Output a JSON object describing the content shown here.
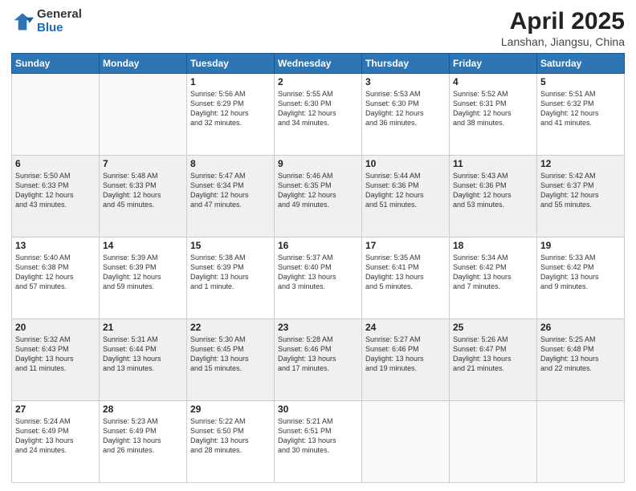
{
  "logo": {
    "general": "General",
    "blue": "Blue"
  },
  "title": {
    "month": "April 2025",
    "location": "Lanshan, Jiangsu, China"
  },
  "weekdays": [
    "Sunday",
    "Monday",
    "Tuesday",
    "Wednesday",
    "Thursday",
    "Friday",
    "Saturday"
  ],
  "days": [
    {
      "num": "",
      "info": ""
    },
    {
      "num": "",
      "info": ""
    },
    {
      "num": "1",
      "info": "Sunrise: 5:56 AM\nSunset: 6:29 PM\nDaylight: 12 hours\nand 32 minutes."
    },
    {
      "num": "2",
      "info": "Sunrise: 5:55 AM\nSunset: 6:30 PM\nDaylight: 12 hours\nand 34 minutes."
    },
    {
      "num": "3",
      "info": "Sunrise: 5:53 AM\nSunset: 6:30 PM\nDaylight: 12 hours\nand 36 minutes."
    },
    {
      "num": "4",
      "info": "Sunrise: 5:52 AM\nSunset: 6:31 PM\nDaylight: 12 hours\nand 38 minutes."
    },
    {
      "num": "5",
      "info": "Sunrise: 5:51 AM\nSunset: 6:32 PM\nDaylight: 12 hours\nand 41 minutes."
    },
    {
      "num": "6",
      "info": "Sunrise: 5:50 AM\nSunset: 6:33 PM\nDaylight: 12 hours\nand 43 minutes."
    },
    {
      "num": "7",
      "info": "Sunrise: 5:48 AM\nSunset: 6:33 PM\nDaylight: 12 hours\nand 45 minutes."
    },
    {
      "num": "8",
      "info": "Sunrise: 5:47 AM\nSunset: 6:34 PM\nDaylight: 12 hours\nand 47 minutes."
    },
    {
      "num": "9",
      "info": "Sunrise: 5:46 AM\nSunset: 6:35 PM\nDaylight: 12 hours\nand 49 minutes."
    },
    {
      "num": "10",
      "info": "Sunrise: 5:44 AM\nSunset: 6:36 PM\nDaylight: 12 hours\nand 51 minutes."
    },
    {
      "num": "11",
      "info": "Sunrise: 5:43 AM\nSunset: 6:36 PM\nDaylight: 12 hours\nand 53 minutes."
    },
    {
      "num": "12",
      "info": "Sunrise: 5:42 AM\nSunset: 6:37 PM\nDaylight: 12 hours\nand 55 minutes."
    },
    {
      "num": "13",
      "info": "Sunrise: 5:40 AM\nSunset: 6:38 PM\nDaylight: 12 hours\nand 57 minutes."
    },
    {
      "num": "14",
      "info": "Sunrise: 5:39 AM\nSunset: 6:39 PM\nDaylight: 12 hours\nand 59 minutes."
    },
    {
      "num": "15",
      "info": "Sunrise: 5:38 AM\nSunset: 6:39 PM\nDaylight: 13 hours\nand 1 minute."
    },
    {
      "num": "16",
      "info": "Sunrise: 5:37 AM\nSunset: 6:40 PM\nDaylight: 13 hours\nand 3 minutes."
    },
    {
      "num": "17",
      "info": "Sunrise: 5:35 AM\nSunset: 6:41 PM\nDaylight: 13 hours\nand 5 minutes."
    },
    {
      "num": "18",
      "info": "Sunrise: 5:34 AM\nSunset: 6:42 PM\nDaylight: 13 hours\nand 7 minutes."
    },
    {
      "num": "19",
      "info": "Sunrise: 5:33 AM\nSunset: 6:42 PM\nDaylight: 13 hours\nand 9 minutes."
    },
    {
      "num": "20",
      "info": "Sunrise: 5:32 AM\nSunset: 6:43 PM\nDaylight: 13 hours\nand 11 minutes."
    },
    {
      "num": "21",
      "info": "Sunrise: 5:31 AM\nSunset: 6:44 PM\nDaylight: 13 hours\nand 13 minutes."
    },
    {
      "num": "22",
      "info": "Sunrise: 5:30 AM\nSunset: 6:45 PM\nDaylight: 13 hours\nand 15 minutes."
    },
    {
      "num": "23",
      "info": "Sunrise: 5:28 AM\nSunset: 6:46 PM\nDaylight: 13 hours\nand 17 minutes."
    },
    {
      "num": "24",
      "info": "Sunrise: 5:27 AM\nSunset: 6:46 PM\nDaylight: 13 hours\nand 19 minutes."
    },
    {
      "num": "25",
      "info": "Sunrise: 5:26 AM\nSunset: 6:47 PM\nDaylight: 13 hours\nand 21 minutes."
    },
    {
      "num": "26",
      "info": "Sunrise: 5:25 AM\nSunset: 6:48 PM\nDaylight: 13 hours\nand 22 minutes."
    },
    {
      "num": "27",
      "info": "Sunrise: 5:24 AM\nSunset: 6:49 PM\nDaylight: 13 hours\nand 24 minutes."
    },
    {
      "num": "28",
      "info": "Sunrise: 5:23 AM\nSunset: 6:49 PM\nDaylight: 13 hours\nand 26 minutes."
    },
    {
      "num": "29",
      "info": "Sunrise: 5:22 AM\nSunset: 6:50 PM\nDaylight: 13 hours\nand 28 minutes."
    },
    {
      "num": "30",
      "info": "Sunrise: 5:21 AM\nSunset: 6:51 PM\nDaylight: 13 hours\nand 30 minutes."
    },
    {
      "num": "",
      "info": ""
    },
    {
      "num": "",
      "info": ""
    },
    {
      "num": "",
      "info": ""
    }
  ]
}
